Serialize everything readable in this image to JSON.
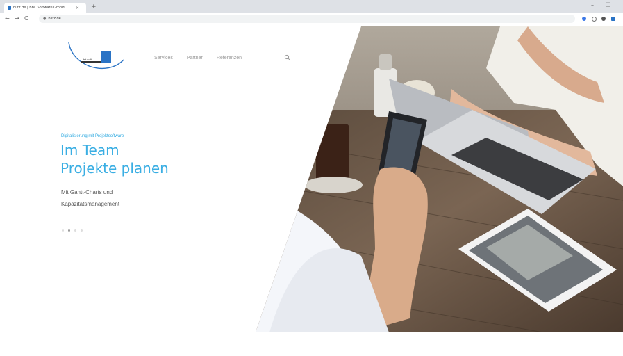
{
  "browser": {
    "tab_title": "blitz.de | BBL Software GmbH",
    "tab_close": "×",
    "new_tab": "+",
    "minimize": "–",
    "restore": "❐",
    "url": "blitz.de",
    "back": "←",
    "forward": "→",
    "reload": "C"
  },
  "nav": {
    "items": [
      "Services",
      "Partner",
      "Referenzen"
    ]
  },
  "hero": {
    "eyebrow": "Digitalisierung mit Projektsoftware",
    "headline_line1": "Im Team",
    "headline_line2": "Projekte planen",
    "subline_line1": "Mit Gantt-Charts und",
    "subline_line2": "Kapazitätsmanagement",
    "slide_count": 4,
    "active_slide": 2
  },
  "colors": {
    "accent": "#2ba8e0",
    "logo_blue": "#2a73c5"
  },
  "icons": {
    "search": "search-icon",
    "lock": "lock-icon"
  }
}
